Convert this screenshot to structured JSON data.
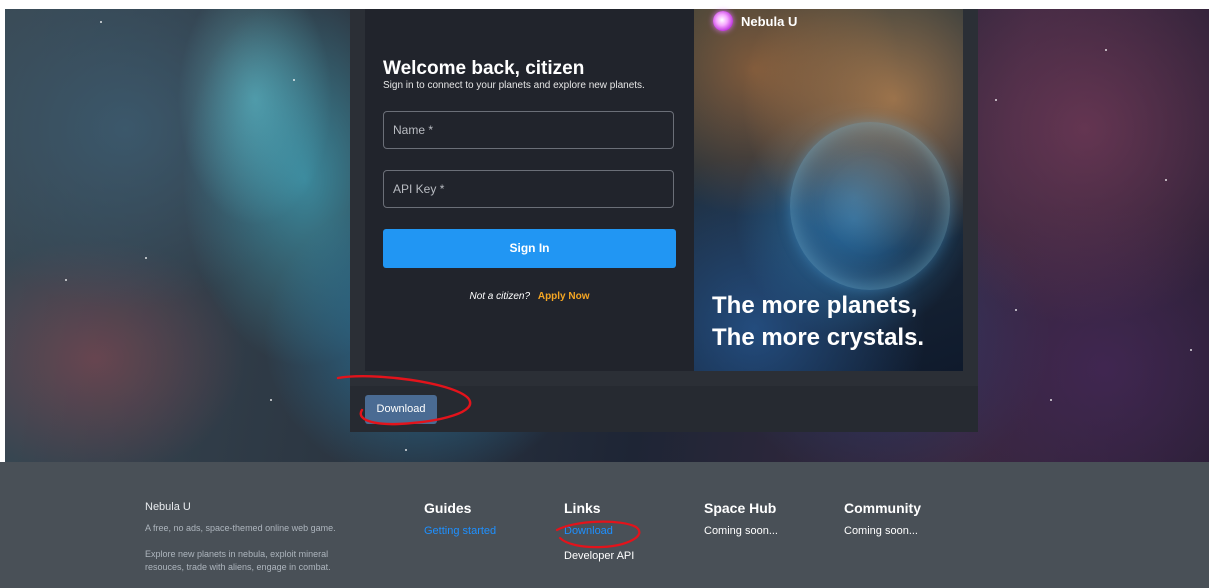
{
  "hero": {
    "login": {
      "title": "Welcome back, citizen",
      "subtitle": "Sign in to connect to your planets and explore new planets.",
      "name_placeholder": "Name *",
      "api_key_placeholder": "API Key *",
      "signin_label": "Sign In",
      "not_citizen_text": "Not a citizen?",
      "apply_label": "Apply Now"
    },
    "brand": {
      "name": "Nebula U",
      "logo_icon": "nebula-logo-icon"
    },
    "tagline_line1": "The more planets,",
    "tagline_line2": "The more crystals.",
    "download_label": "Download"
  },
  "footer": {
    "brand": "Nebula U",
    "desc1": "A free, no ads, space-themed online web game.",
    "desc2": "Explore new planets in nebula, exploit mineral resouces, trade with aliens, engage in combat.",
    "guides": {
      "title": "Guides",
      "items": [
        "Getting started"
      ]
    },
    "links": {
      "title": "Links",
      "items": [
        "Download",
        "Developer API"
      ]
    },
    "space_hub": {
      "title": "Space Hub",
      "text": "Coming soon..."
    },
    "community": {
      "title": "Community",
      "text": "Coming soon..."
    }
  },
  "colors": {
    "primary": "#2196f3",
    "accent": "#f5a623",
    "download_button": "#4a6b93",
    "footer_bg": "#495057",
    "link": "#1e90ff",
    "annotation": "#e3131b"
  }
}
